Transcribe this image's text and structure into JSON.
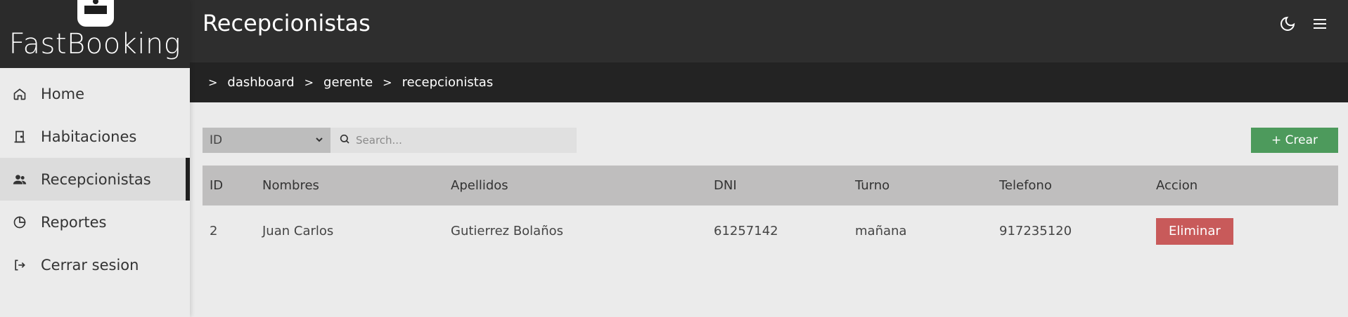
{
  "brand": {
    "name": "FastBooking",
    "logo": "reception-desk-icon"
  },
  "sidebar": {
    "items": [
      {
        "label": "Home",
        "icon": "home-icon"
      },
      {
        "label": "Habitaciones",
        "icon": "door-icon"
      },
      {
        "label": "Recepcionistas",
        "icon": "users-icon",
        "active": true
      },
      {
        "label": "Reportes",
        "icon": "pie-chart-icon"
      },
      {
        "label": "Cerrar sesion",
        "icon": "logout-icon"
      }
    ]
  },
  "header": {
    "title": "Recepcionistas",
    "icons": [
      "moon-icon",
      "menu-icon"
    ]
  },
  "breadcrumb": [
    "dashboard",
    "gerente",
    "recepcionistas"
  ],
  "filters": {
    "select_value": "ID",
    "search_placeholder": "Search..."
  },
  "actions": {
    "create_label": "+ Crear"
  },
  "table": {
    "columns": [
      "ID",
      "Nombres",
      "Apellidos",
      "DNI",
      "Turno",
      "Telefono",
      "Accion"
    ],
    "rows": [
      {
        "id": "2",
        "nombres": "Juan Carlos",
        "apellidos": "Gutierrez Bolaños",
        "dni": "61257142",
        "turno": "mañana",
        "telefono": "917235120",
        "accion": "Eliminar"
      }
    ]
  },
  "colors": {
    "header_bg": "#2e2e2e",
    "breadcrumb_bg": "#232323",
    "create_button": "#4d9a5c",
    "delete_button": "#c85a5a"
  }
}
